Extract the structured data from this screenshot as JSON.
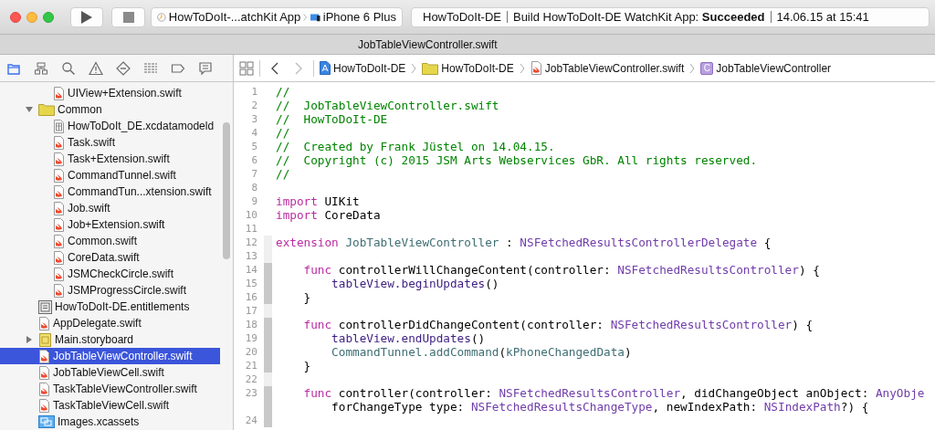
{
  "toolbar": {
    "window_controls": [
      {
        "kind": "close"
      },
      {
        "kind": "minimize"
      },
      {
        "kind": "zoom"
      }
    ],
    "scheme": {
      "target": "HowToDoIt-...atchKit App",
      "device": "iPhone 6 Plus"
    },
    "status": {
      "project": "HowToDoIt-DE",
      "message": "Build HowToDoIt-DE WatchKit App: **Succeeded**",
      "time": "14.06.15 at 15:41"
    }
  },
  "tab_title": "JobTableViewController.swift",
  "navigator_tabs": [
    {
      "kind": "files",
      "selected": true
    },
    {
      "kind": "symbols",
      "selected": false
    },
    {
      "kind": "search",
      "selected": false
    },
    {
      "kind": "issues",
      "selected": false
    },
    {
      "kind": "tests",
      "selected": false
    },
    {
      "kind": "debug",
      "selected": false
    },
    {
      "kind": "breakpoints",
      "selected": false
    },
    {
      "kind": "reports",
      "selected": false
    }
  ],
  "sidebar": {
    "items": [
      {
        "children": [
          {
            "label": "UIView+Extension.swift",
            "kind": "swift",
            "selected": false
          }
        ]
      },
      {
        "label": "Common",
        "kind": "folder",
        "expanded": true,
        "selected": false,
        "children": [
          {
            "label": "HowToDoIt_DE.xcdatamodeld",
            "kind": "datamodel",
            "selected": false
          },
          {
            "label": "Task.swift",
            "kind": "swift",
            "selected": false
          },
          {
            "label": "Task+Extension.swift",
            "kind": "swift",
            "selected": false
          },
          {
            "label": "CommandTunnel.swift",
            "kind": "swift",
            "selected": false
          },
          {
            "label": "CommandTun...xtension.swift",
            "kind": "swift",
            "selected": false
          },
          {
            "label": "Job.swift",
            "kind": "swift",
            "selected": false
          },
          {
            "label": "Job+Extension.swift",
            "kind": "swift",
            "selected": false
          },
          {
            "label": "Common.swift",
            "kind": "swift",
            "selected": false
          },
          {
            "label": "CoreData.swift",
            "kind": "swift",
            "selected": false
          },
          {
            "label": "JSMCheckCircle.swift",
            "kind": "swift",
            "selected": false
          },
          {
            "label": "JSMProgressCircle.swift",
            "kind": "swift",
            "selected": false
          }
        ]
      },
      {
        "label": "HowToDoIt-DE.entitlements",
        "kind": "entitlements",
        "selected": false
      },
      {
        "label": "AppDelegate.swift",
        "kind": "swift",
        "selected": false
      },
      {
        "label": "Main.storyboard",
        "kind": "storyboard",
        "expanded": false,
        "selected": false
      },
      {
        "label": "JobTableViewController.swift",
        "kind": "swift",
        "selected": true
      },
      {
        "label": "JobTableViewCell.swift",
        "kind": "swift",
        "selected": false
      },
      {
        "label": "TaskTableViewController.swift",
        "kind": "swift",
        "selected": false
      },
      {
        "label": "TaskTableViewCell.swift",
        "kind": "swift",
        "selected": false
      },
      {
        "label": "Images.xcassets",
        "kind": "assets",
        "selected": false
      }
    ]
  },
  "jump_bar": {
    "back": {
      "disabled": false
    },
    "forward": {
      "disabled": true
    },
    "crumbs": [
      {
        "kind": "project",
        "label": "HowToDoIt-DE"
      },
      {
        "kind": "folder",
        "label": "HowToDoIt-DE"
      },
      {
        "kind": "swift",
        "label": "JobTableViewController.swift"
      },
      {
        "kind": "class",
        "icon_letter": "C",
        "label": "JobTableViewController"
      }
    ]
  },
  "code": {
    "lines": [
      {
        "number": "1",
        "in_extension": false,
        "in_function": false,
        "segments": [
          {
            "kind": "comment",
            "text": "//"
          }
        ]
      },
      {
        "number": "2",
        "in_extension": false,
        "in_function": false,
        "segments": [
          {
            "kind": "comment",
            "text": "//  JobTableViewController.swift"
          }
        ]
      },
      {
        "number": "3",
        "in_extension": false,
        "in_function": false,
        "segments": [
          {
            "kind": "comment",
            "text": "//  HowToDoIt-DE"
          }
        ]
      },
      {
        "number": "4",
        "in_extension": false,
        "in_function": false,
        "segments": [
          {
            "kind": "comment",
            "text": "//"
          }
        ]
      },
      {
        "number": "5",
        "in_extension": false,
        "in_function": false,
        "segments": [
          {
            "kind": "comment",
            "text": "//  Created by Frank Jüstel on 14.04.15."
          }
        ]
      },
      {
        "number": "6",
        "in_extension": false,
        "in_function": false,
        "segments": [
          {
            "kind": "comment",
            "text": "//  Copyright (c) 2015 JSM Arts Webservices GbR. All rights reserved."
          }
        ]
      },
      {
        "number": "7",
        "in_extension": false,
        "in_function": false,
        "segments": [
          {
            "kind": "comment",
            "text": "//"
          }
        ]
      },
      {
        "number": "8",
        "in_extension": false,
        "in_function": false
      },
      {
        "number": "9",
        "in_extension": false,
        "in_function": false,
        "segments": [
          {
            "kind": "keyword",
            "text": "import"
          },
          {
            "kind": "plain",
            "text": " UIKit"
          }
        ]
      },
      {
        "number": "10",
        "in_extension": false,
        "in_function": false,
        "segments": [
          {
            "kind": "keyword",
            "text": "import"
          },
          {
            "kind": "plain",
            "text": " CoreData"
          }
        ]
      },
      {
        "number": "11",
        "in_extension": false,
        "in_function": false
      },
      {
        "number": "12",
        "in_extension": true,
        "in_function": false,
        "segments": [
          {
            "kind": "keyword",
            "text": "extension"
          },
          {
            "kind": "project",
            "text": " JobTableViewController"
          },
          {
            "kind": "plain",
            "text": " : "
          },
          {
            "kind": "type",
            "text": "NSFetchedResultsControllerDelegate"
          },
          {
            "kind": "plain",
            "text": " {"
          }
        ]
      },
      {
        "number": "13",
        "in_extension": true,
        "in_function": false
      },
      {
        "number": "14",
        "in_extension": true,
        "in_function": true,
        "segments": [
          {
            "kind": "keyword",
            "text": "    func"
          },
          {
            "kind": "plain",
            "text": " controllerWillChangeContent(controller: "
          },
          {
            "kind": "type",
            "text": "NSFetchedResultsController"
          },
          {
            "kind": "plain",
            "text": ") {"
          }
        ]
      },
      {
        "number": "15",
        "in_extension": true,
        "in_function": true,
        "segments": [
          {
            "kind": "system",
            "text": "        tableView"
          },
          {
            "kind": "system",
            "text": ".beginUpdates"
          },
          {
            "kind": "plain",
            "text": "()"
          }
        ]
      },
      {
        "number": "16",
        "in_extension": true,
        "in_function": true,
        "segments": [
          {
            "kind": "plain",
            "text": "    }"
          }
        ]
      },
      {
        "number": "17",
        "in_extension": true,
        "in_function": false
      },
      {
        "number": "18",
        "in_extension": true,
        "in_function": true,
        "segments": [
          {
            "kind": "keyword",
            "text": "    func"
          },
          {
            "kind": "plain",
            "text": " controllerDidChangeContent(controller: "
          },
          {
            "kind": "type",
            "text": "NSFetchedResultsController"
          },
          {
            "kind": "plain",
            "text": ") {"
          }
        ]
      },
      {
        "number": "19",
        "in_extension": true,
        "in_function": true,
        "segments": [
          {
            "kind": "system",
            "text": "        tableView"
          },
          {
            "kind": "system",
            "text": ".endUpdates"
          },
          {
            "kind": "plain",
            "text": "()"
          }
        ]
      },
      {
        "number": "20",
        "in_extension": true,
        "in_function": true,
        "segments": [
          {
            "kind": "project",
            "text": "        CommandTunnel"
          },
          {
            "kind": "project",
            "text": ".addCommand"
          },
          {
            "kind": "plain",
            "text": "("
          },
          {
            "kind": "project",
            "text": "kPhoneChangedData"
          },
          {
            "kind": "plain",
            "text": ")"
          }
        ]
      },
      {
        "number": "21",
        "in_extension": true,
        "in_function": true,
        "segments": [
          {
            "kind": "plain",
            "text": "    }"
          }
        ]
      },
      {
        "number": "22",
        "in_extension": true,
        "in_function": false
      },
      {
        "number": "23",
        "in_extension": true,
        "in_function": true,
        "segments": [
          {
            "kind": "keyword",
            "text": "    func"
          },
          {
            "kind": "plain",
            "text": " controller(controller: "
          },
          {
            "kind": "type",
            "text": "NSFetchedResultsController"
          },
          {
            "kind": "plain",
            "text": ", didChangeObject anObject: "
          },
          {
            "kind": "type",
            "text": "AnyObje"
          }
        ]
      },
      {
        "in_extension": true,
        "in_function": true,
        "segments": [
          {
            "kind": "plain",
            "text": "        forChangeType type: "
          },
          {
            "kind": "type",
            "text": "NSFetchedResultsChangeType"
          },
          {
            "kind": "plain",
            "text": ", newIndexPath: "
          },
          {
            "kind": "type",
            "text": "NSIndexPath"
          },
          {
            "kind": "plain",
            "text": "?) {"
          }
        ]
      },
      {
        "number": "24",
        "in_extension": true,
        "in_function": true
      }
    ]
  }
}
